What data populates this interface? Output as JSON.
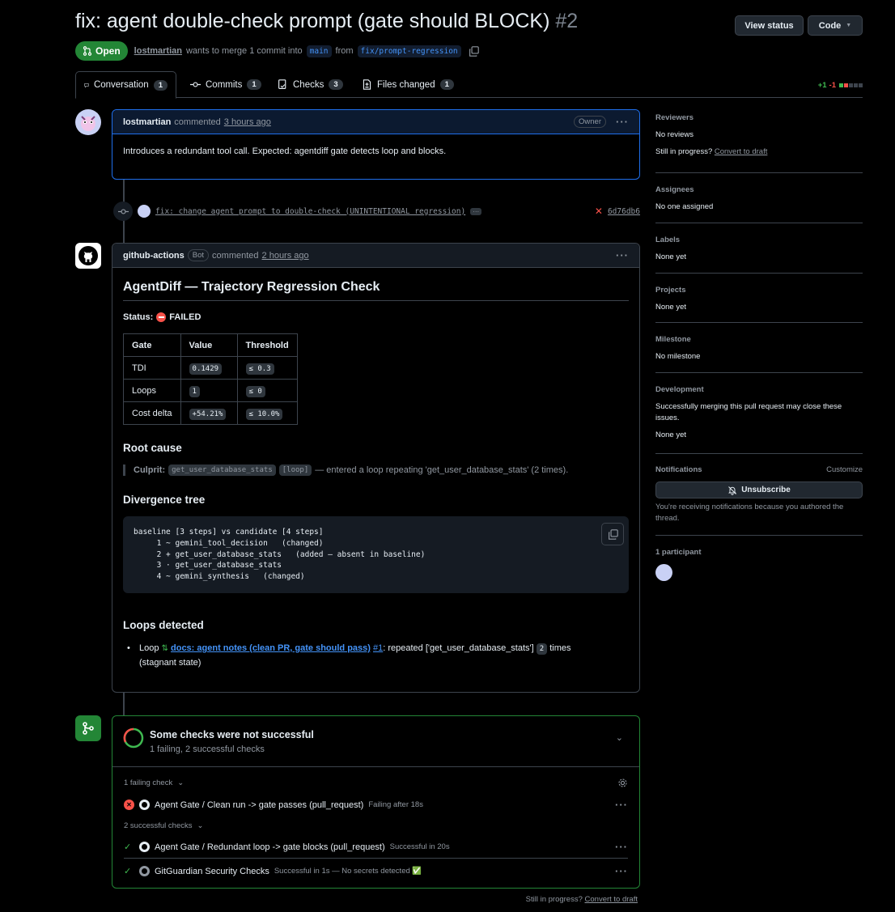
{
  "pr": {
    "title": "fix: agent double-check prompt (gate should BLOCK)",
    "number": "#2",
    "status": "Open",
    "author": "lostmartian",
    "merge_text": "wants to merge 1 commit into",
    "base": "main",
    "from_text": "from",
    "head": "fix/prompt-regression"
  },
  "header": {
    "view_status": "View status",
    "code": "Code"
  },
  "tabs": [
    {
      "label": "Conversation",
      "count": "1"
    },
    {
      "label": "Commits",
      "count": "1"
    },
    {
      "label": "Checks",
      "count": "3"
    },
    {
      "label": "Files changed",
      "count": "1"
    }
  ],
  "diffstat": {
    "add": "+1",
    "del": "-1"
  },
  "comment1": {
    "author": "lostmartian",
    "verb": "commented",
    "time": "3 hours ago",
    "role": "Owner",
    "body": "Introduces a redundant tool call. Expected: agentdiff gate detects loop and blocks."
  },
  "commit": {
    "message": "fix: change agent prompt to double-check (UNINTENTIONAL regression)",
    "ellipsis": "···",
    "sha": "6d76db6"
  },
  "comment2": {
    "author": "github-actions",
    "bot": "Bot",
    "verb": "commented",
    "time": "2 hours ago",
    "heading": "AgentDiff — Trajectory Regression Check",
    "status_label": "Status:",
    "status_value": "FAILED",
    "table": {
      "headers": [
        "Gate",
        "Value",
        "Threshold"
      ],
      "rows": [
        [
          "TDI",
          "0.1429",
          "≤ 0.3"
        ],
        [
          "Loops",
          "1",
          "≤ 0"
        ],
        [
          "Cost delta",
          "+54.21%",
          "≤ 10.0%"
        ]
      ]
    },
    "root_cause_h": "Root cause",
    "culprit_label": "Culprit:",
    "culprit_code": "get_user_database_stats",
    "culprit_tag": "[loop]",
    "culprit_text": "— entered a loop repeating 'get_user_database_stats' (2 times).",
    "divergence_h": "Divergence tree",
    "tree": "baseline [3 steps] vs candidate [4 steps]\n     1 ~ gemini_tool_decision   (changed)\n     2 + get_user_database_stats   (added — absent in baseline)\n     3 · get_user_database_stats\n     4 ~ gemini_synthesis   (changed)",
    "loops_h": "Loops detected",
    "loop_prefix": "Loop",
    "loop_link": "docs: agent notes (clean PR, gate should pass)",
    "loop_ref": "#1",
    "loop_text": ": repeated ['get_user_database_stats']",
    "loop_count": "2",
    "loop_suffix": "times",
    "loop_tail": "(stagnant state)"
  },
  "checks": {
    "title": "Some checks were not successful",
    "subtitle": "1 failing, 2 successful checks",
    "failing_group": "1 failing check",
    "success_group": "2 successful checks",
    "items": [
      {
        "name": "Agent Gate / Clean run -> gate passes (pull_request)",
        "status": "Failing after 18s"
      },
      {
        "name": "Agent Gate / Redundant loop -> gate blocks (pull_request)",
        "status": "Successful in 20s"
      },
      {
        "name": "GitGuardian Security Checks",
        "status": "Successful in 1s — No secrets detected ✅"
      }
    ]
  },
  "footer": {
    "still": "Still in progress?",
    "convert": "Convert to draft"
  },
  "sidebar": {
    "reviewers": {
      "h": "Reviewers",
      "v": "No reviews",
      "still": "Still in progress?",
      "convert": "Convert to draft"
    },
    "assignees": {
      "h": "Assignees",
      "v": "No one assigned"
    },
    "labels": {
      "h": "Labels",
      "v": "None yet"
    },
    "projects": {
      "h": "Projects",
      "v": "None yet"
    },
    "milestone": {
      "h": "Milestone",
      "v": "No milestone"
    },
    "development": {
      "h": "Development",
      "v": "Successfully merging this pull request may close these issues.",
      "v2": "None yet"
    },
    "notifications": {
      "h": "Notifications",
      "customize": "Customize",
      "button": "Unsubscribe",
      "note": "You're receiving notifications because you authored the thread."
    },
    "participants": {
      "h": "1 participant"
    }
  },
  "colors": {
    "open": "#238636",
    "link": "#4493f8",
    "fail": "#f85149",
    "success": "#3fb950",
    "border": "#3d444d"
  }
}
